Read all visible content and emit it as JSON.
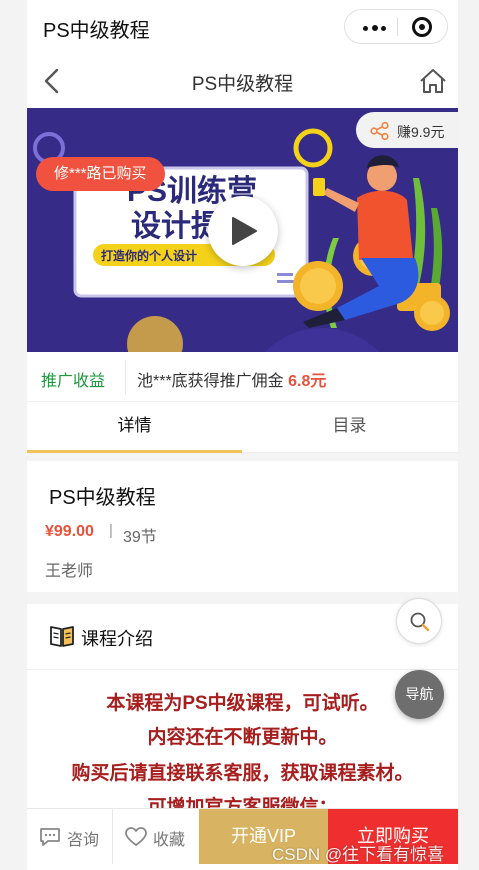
{
  "app": {
    "title": "PS中级教程"
  },
  "nav": {
    "title": "PS中级教程"
  },
  "banner": {
    "buyer_notice": "修***路已购买",
    "earn_label": "赚9.9元",
    "poster_line1": "PS训练营",
    "poster_line2": "设计提",
    "poster_line3": "打造你的个人设计"
  },
  "promo": {
    "label": "推广收益",
    "message": "池***底获得推广佣金",
    "amount": "6.8元"
  },
  "tabs": [
    {
      "label": "详情",
      "active": true
    },
    {
      "label": "目录",
      "active": false
    }
  ],
  "course": {
    "title": "PS中级教程",
    "price": "¥99.00",
    "separator": "|",
    "lessons": "39节",
    "teacher": "王老师"
  },
  "intro": {
    "heading": "课程介绍",
    "lines": [
      "本课程为PS中级课程，可试听。",
      "内容还在不断更新中。",
      "购买后请直接联系客服，获取课程素材。",
      "可增加官方客服微信："
    ]
  },
  "floating": {
    "nav_label": "导航"
  },
  "bottom_bar": {
    "consult": "咨询",
    "collect": "收藏",
    "vip": "开通VIP",
    "buy": "立即购买"
  },
  "watermark": "CSDN @往下看有惊喜",
  "colors": {
    "accent": "#f4c05a",
    "price": "#e8523c",
    "promo_green": "#1c9a3c",
    "buy_red": "#ef2f2f",
    "vip_gold": "#d8b462",
    "intro_text": "#a61e1e"
  }
}
